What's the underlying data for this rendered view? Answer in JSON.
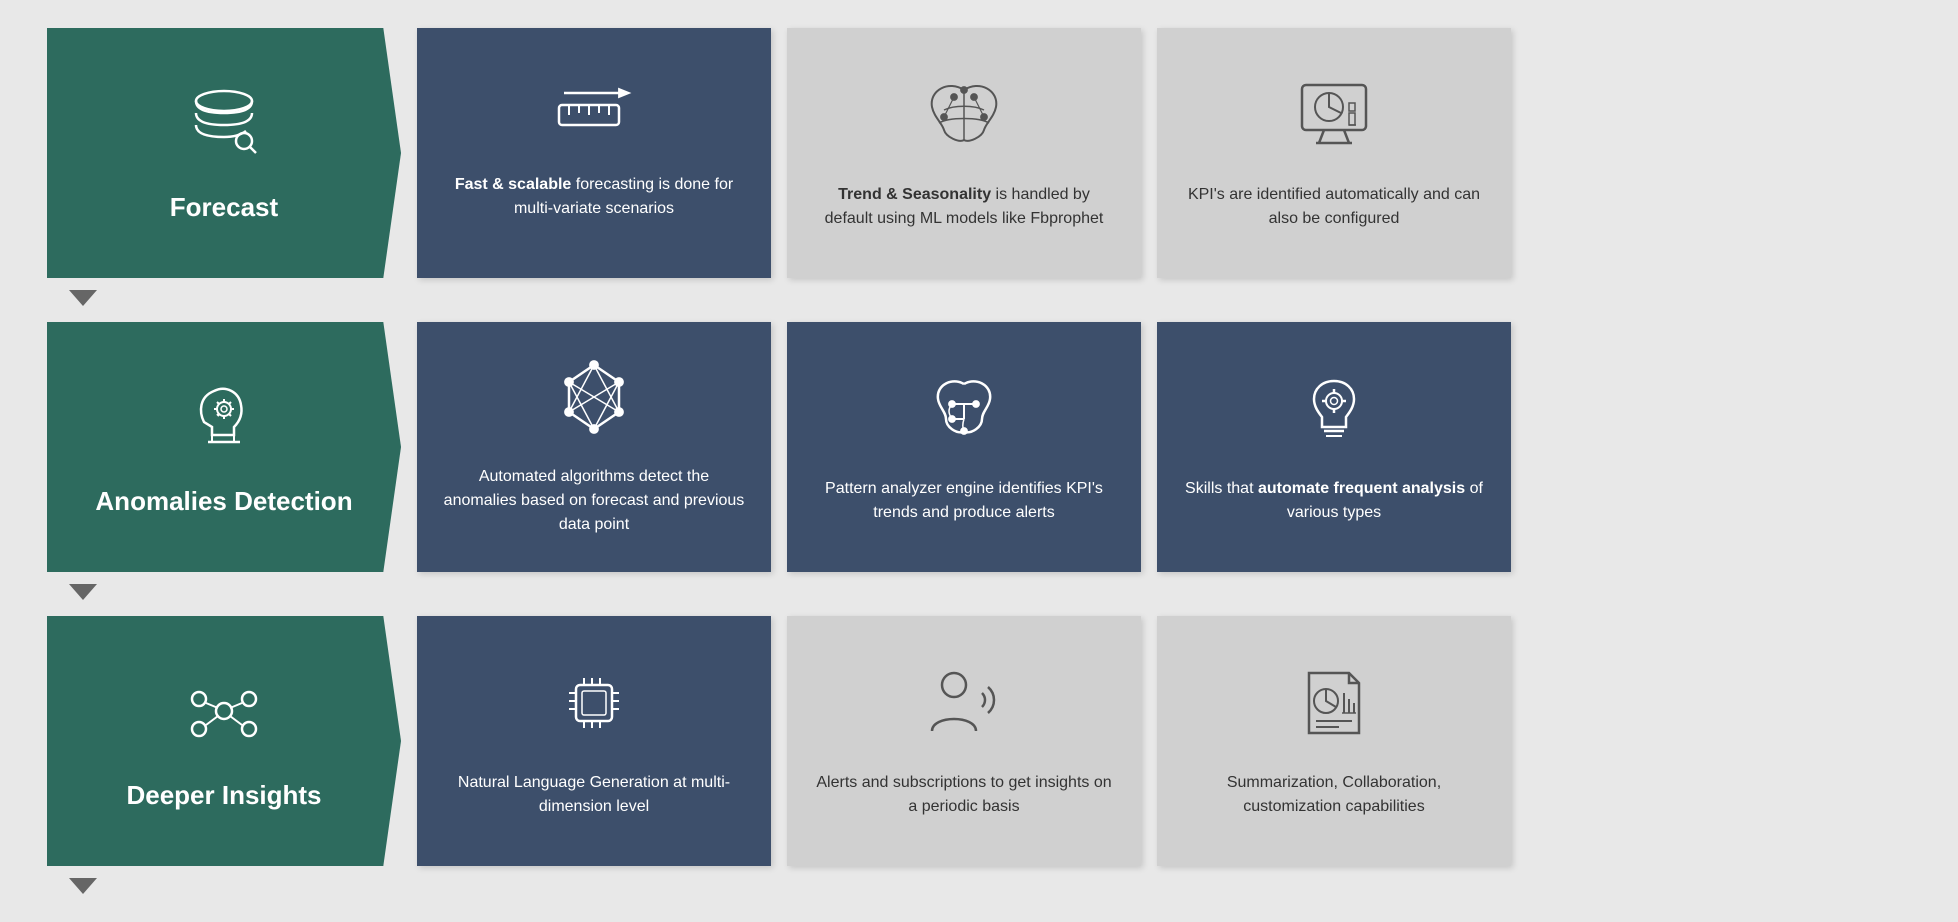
{
  "rows": [
    {
      "id": "row-forecast",
      "category": {
        "title": "Forecast",
        "iconType": "database-search"
      },
      "cells": [
        {
          "style": "dark",
          "iconType": "ruler-arrow",
          "text": "<b>Fast &amp; scalable</b> forecasting is done for multi-variate scenarios"
        },
        {
          "style": "light",
          "iconType": "brain-network",
          "text": "<b>Trend &amp; Seasonality</b> is handled by default using ML models like Fbprophet"
        },
        {
          "style": "light",
          "iconType": "monitor-chart",
          "text": "KPI's are identified automatically and can also be configured"
        }
      ]
    },
    {
      "id": "row-anomalies",
      "category": {
        "title": "Anomalies Detection",
        "iconType": "head-gear"
      },
      "cells": [
        {
          "style": "dark",
          "iconType": "network-nodes",
          "text": "Automated algorithms detect the anomalies based on forecast and previous data point"
        },
        {
          "style": "dark",
          "iconType": "brain-circuit",
          "text": "Pattern analyzer engine identifies KPI's trends and produce alerts"
        },
        {
          "style": "dark",
          "iconType": "lightbulb-gear",
          "text": "Skills that <b>automate frequent analysis</b> of various types"
        }
      ]
    },
    {
      "id": "row-insights",
      "category": {
        "title": "Deeper Insights",
        "iconType": "network-circle"
      },
      "cells": [
        {
          "style": "dark",
          "iconType": "chip",
          "text": "Natural Language Generation at multi-dimension level"
        },
        {
          "style": "light",
          "iconType": "person-sound",
          "text": "Alerts and subscriptions to get insights on a periodic basis"
        },
        {
          "style": "light",
          "iconType": "doc-chart",
          "text": "Summarization, Collaboration, customization capabilities"
        }
      ]
    }
  ]
}
